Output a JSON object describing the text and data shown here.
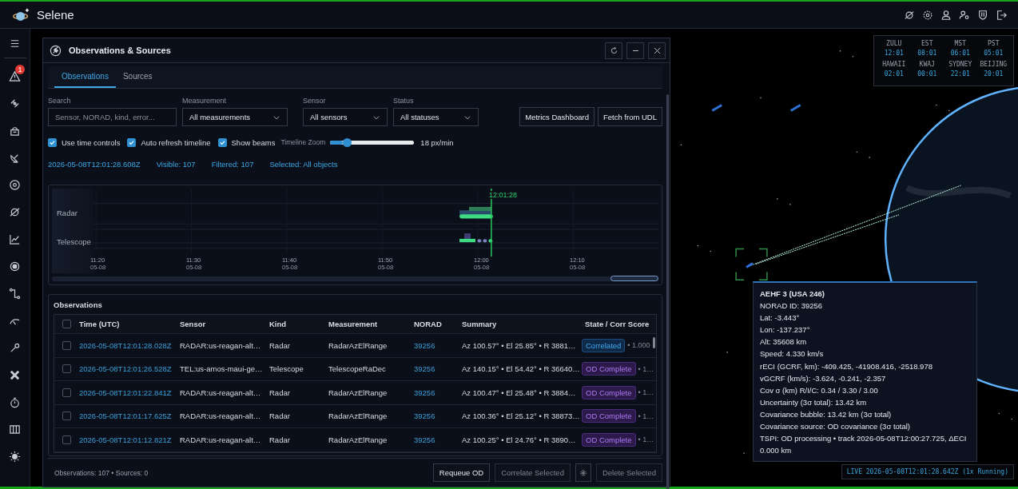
{
  "app": {
    "title": "Selene",
    "alert_count": "1"
  },
  "clocks": [
    {
      "zone": "ZULU",
      "time": "12:01"
    },
    {
      "zone": "EST",
      "time": "08:01"
    },
    {
      "zone": "MST",
      "time": "06:01"
    },
    {
      "zone": "PST",
      "time": "05:01"
    },
    {
      "zone": "HAWAII",
      "time": "02:01"
    },
    {
      "zone": "KWAJ",
      "time": "00:01"
    },
    {
      "zone": "SYDNEY",
      "time": "22:01"
    },
    {
      "zone": "BEIJING",
      "time": "20:01"
    }
  ],
  "panel": {
    "title": "Observations & Sources",
    "tabs": [
      {
        "label": "Observations",
        "selected": true
      },
      {
        "label": "Sources",
        "selected": false
      }
    ],
    "search": {
      "label": "Search",
      "placeholder": "Sensor, NORAD, kind, error..."
    },
    "selects": [
      {
        "label": "Measurement",
        "value": "All measurements"
      },
      {
        "label": "Sensor",
        "value": "All sensors"
      },
      {
        "label": "Status",
        "value": "All statuses"
      }
    ],
    "actions": [
      "Metrics Dashboard",
      "Fetch from UDL"
    ],
    "options": [
      {
        "label": "Use time controls",
        "checked": true
      },
      {
        "label": "Auto refresh timeline",
        "checked": true
      },
      {
        "label": "Show beams",
        "checked": true
      }
    ],
    "zoom": {
      "label": "Timeline Zoom",
      "level": 0.15,
      "reading": "18 px/min"
    },
    "status": [
      "2026-05-08T12:01:28.608Z",
      "Visible: 107",
      "Filtered: 107",
      "Selected: All objects"
    ],
    "timeline": {
      "lanes": [
        "Radar",
        "Telescope"
      ],
      "cursor": "12:01:28",
      "ticks": [
        {
          "time": "11:20",
          "date": "05-08"
        },
        {
          "time": "11:30",
          "date": "05-08"
        },
        {
          "time": "11:40",
          "date": "05-08"
        },
        {
          "time": "11:50",
          "date": "05-08"
        },
        {
          "time": "12:00",
          "date": "05-08"
        },
        {
          "time": "12:10",
          "date": "05-08"
        }
      ]
    },
    "table": {
      "title": "Observations",
      "all_checked": false,
      "columns": [
        "Time (UTC)",
        "Sensor",
        "Kind",
        "Measurement",
        "NORAD",
        "Summary",
        "State / Corr Score"
      ],
      "rows": [
        {
          "checked": false,
          "time": "2026-05-08T12:01:28.028Z",
          "sensor": "RADAR:us-reagan-alt…",
          "kind": "Radar",
          "measurement": "RadarAzElRange",
          "norad": "39256",
          "summary": "Az 100.57° • El 25.85° • R 3881…",
          "state": {
            "kind": "correlated",
            "label": "Correlated"
          },
          "score": "• 1.000"
        },
        {
          "checked": false,
          "time": "2026-05-08T12:01:26.528Z",
          "sensor": "TEL:us-amos-maui-ge…",
          "kind": "Telescope",
          "measurement": "TelescopeRaDec",
          "norad": "39256",
          "summary": "Az 140.15° • El 54.42° • R 36640…",
          "state": {
            "kind": "od_complete",
            "label": "OD Complete"
          },
          "score": "• 1…"
        },
        {
          "checked": false,
          "time": "2026-05-08T12:01:22.841Z",
          "sensor": "RADAR:us-reagan-alt…",
          "kind": "Radar",
          "measurement": "RadarAzElRange",
          "norad": "39256",
          "summary": "Az 100.47° • El 25.48° • R 3884…",
          "state": {
            "kind": "od_complete",
            "label": "OD Complete"
          },
          "score": "• 1…"
        },
        {
          "checked": false,
          "time": "2026-05-08T12:01:17.625Z",
          "sensor": "RADAR:us-reagan-alt…",
          "kind": "Radar",
          "measurement": "RadarAzElRange",
          "norad": "39256",
          "summary": "Az 100.36° • El 25.12° • R 38873…",
          "state": {
            "kind": "od_complete",
            "label": "OD Complete"
          },
          "score": "• 1…"
        },
        {
          "checked": false,
          "time": "2026-05-08T12:01:12.821Z",
          "sensor": "RADAR:us-reagan-alt…",
          "kind": "Radar",
          "measurement": "RadarAzElRange",
          "norad": "39256",
          "summary": "Az 100.25° • El 24.76° • R 3890…",
          "state": {
            "kind": "od_complete",
            "label": "OD Complete"
          },
          "score": "• 1…"
        }
      ]
    },
    "footer": {
      "counts": "Observations: 107 • Sources: 0",
      "buttons": [
        {
          "kind": "text",
          "label": "Requeue OD",
          "disabled": false
        },
        {
          "kind": "text",
          "label": "Correlate Selected",
          "disabled": true
        },
        {
          "kind": "gear",
          "disabled": false
        },
        {
          "kind": "text",
          "label": "Delete Selected",
          "disabled": true
        }
      ]
    }
  },
  "tooltip": {
    "title": "AEHF 3 (USA 246)",
    "lines": [
      "NORAD ID: 39256",
      "Lat: -3.443°",
      "Lon: -137.237°",
      "Alt: 35608 km",
      "Speed: 4.330 km/s",
      "rECI (GCRF, km): -409.425, -41908.416, -2518.978",
      "vGCRF (km/s): -3.624, -0.241, -2.357",
      "Cov σ (km) R/I/C: 0.34 / 3.30 / 3.00",
      "Uncertainty (3σ total): 13.42 km",
      "Covariance bubble: 13.42 km (3σ total)",
      "Covariance source: OD covariance (3σ total)",
      "TSPI: OD processing • track 2026-05-08T12:00:27.725, ΔECI 0.000 km"
    ]
  },
  "live": "LIVE 2026-05-08T12:01:28.642Z (1x Running)"
}
